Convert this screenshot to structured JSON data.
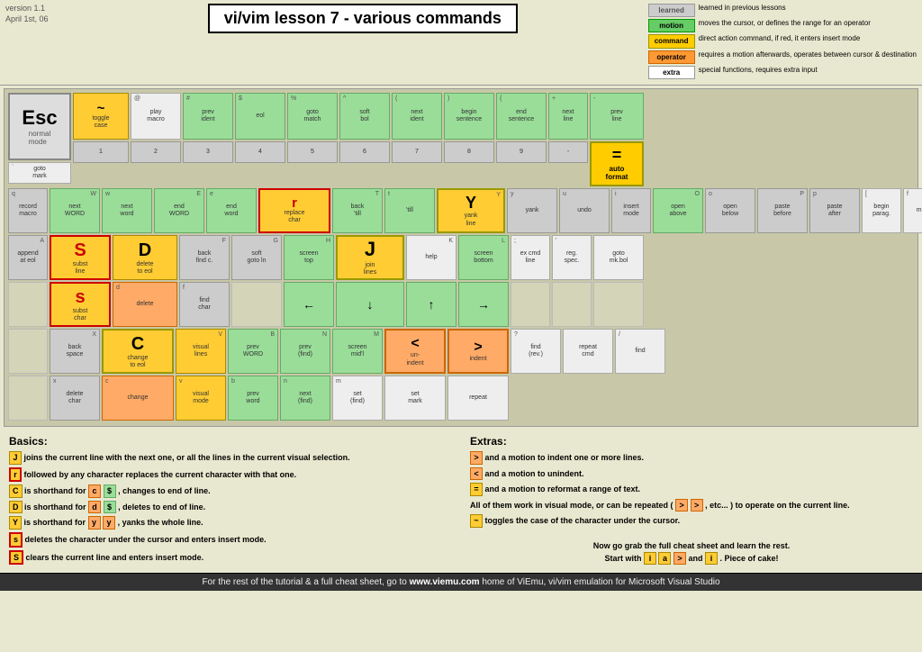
{
  "header": {
    "version": "version 1.1",
    "date": "April 1st, 06",
    "title": "vi/vim lesson 7 - various commands"
  },
  "legend": {
    "items": [
      {
        "badge": "learned",
        "type": "learned",
        "text": "learned in previous lessons"
      },
      {
        "badge": "motion",
        "type": "motion",
        "text": "moves the cursor, or defines the range for an operator"
      },
      {
        "badge": "command",
        "type": "command",
        "text": "direct action command. if red, it enters insert mode requires a motion afterwards, operates between cursor & destination"
      },
      {
        "badge": "operator",
        "type": "operator",
        "text": ""
      },
      {
        "badge": "extra",
        "type": "extra",
        "text": "special functions, requires extra input"
      }
    ]
  },
  "footer": {
    "text": "For the rest of the tutorial & a full cheat sheet, go to ",
    "link": "www.viemu.com",
    "suffix": " home of ViEmu, vi/vim emulation for Microsoft Visual Studio"
  },
  "basics": {
    "title": "Basics:",
    "lines": [
      "J joins the current line with the next one, or all the lines in the current visual selection.",
      "r followed by any character replaces the current character with that one.",
      "C is shorthand for c $ , changes to end of line.",
      "D is shorthand for d $ , deletes to end of line.",
      "Y is shorthand for y y , yanks the whole line.",
      "s deletes the character under the cursor and enters insert mode.",
      "S clears the current line and enters insert mode."
    ]
  },
  "extras": {
    "title": "Extras:",
    "lines": [
      "> and a motion to indent one or more lines.",
      "< and a motion to unindent.",
      "= and a motion to reformat a range of text.",
      "All of them work in visual mode, or can be repeated ( > > , etc... ) to operate on the current line.",
      "~ toggles the case of the character under the cursor.",
      "Now go grab the full cheat sheet and learn the rest. Start with i a > and i . Piece of cake!"
    ]
  }
}
